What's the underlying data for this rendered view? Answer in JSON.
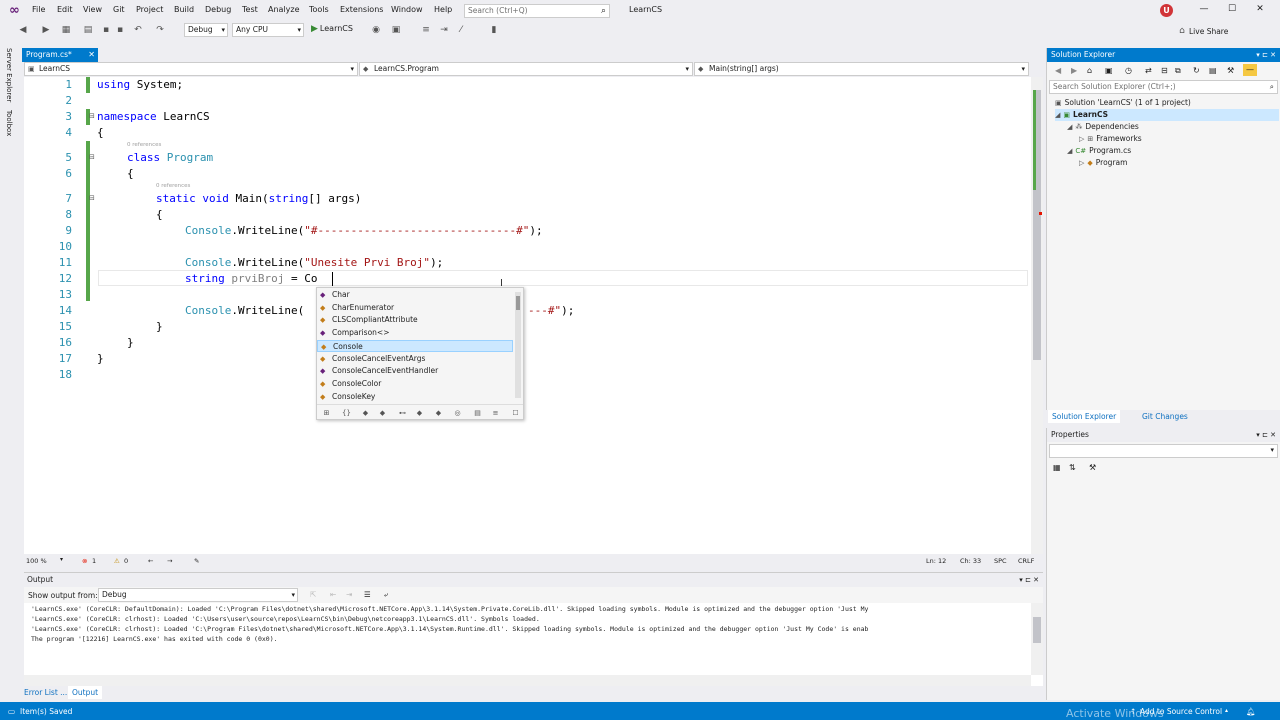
{
  "titlebar": {
    "menu": [
      "File",
      "Edit",
      "View",
      "Git",
      "Project",
      "Build",
      "Debug",
      "Test",
      "Analyze",
      "Tools",
      "Extensions",
      "Window",
      "Help"
    ],
    "search_placeholder": "Search (Ctrl+Q)",
    "project_name": "LearnCS",
    "avatar": "U"
  },
  "toolbar": {
    "config": "Debug",
    "platform": "Any CPU",
    "run_label": "LearnCS",
    "live_share": "Live Share"
  },
  "left_tabs": [
    "Server Explorer",
    "Toolbox"
  ],
  "document": {
    "tab_label": "Program.cs*",
    "nav_project": "LearnCS",
    "nav_class": "LearnCS.Program",
    "nav_member": "Main(string[] args)"
  },
  "editor": {
    "line_numbers": [
      "1",
      "2",
      "3",
      "4",
      "5",
      "6",
      "7",
      "8",
      "9",
      "10",
      "11",
      "12",
      "13",
      "14",
      "15",
      "16",
      "17",
      "18"
    ],
    "lines": {
      "l1_kw": "using",
      "l1_rest": " System;",
      "l3_kw": "namespace",
      "l3_rest": " LearnCS",
      "l4": "{",
      "lens_class": "0 references",
      "l5_kw": "class",
      "l5_ty": " Program",
      "l6": "{",
      "lens_main": "0 references",
      "l7_kw1": "static",
      "l7_kw2": " void",
      "l7_rest": " Main(",
      "l7_kw3": "string",
      "l7_rest2": "[] args)",
      "l8": "{",
      "l9_ty": "Console",
      "l9_rest": ".WriteLine(",
      "l9_str": "\"#------------------------------#\"",
      "l9_end": ");",
      "l11_ty": "Console",
      "l11_rest": ".WriteLine(",
      "l11_str": "\"Unesite Prvi Broj\"",
      "l11_end": ");",
      "l12_kw": "string",
      "l12_var": " prviBroj",
      "l12_rest": " = Co",
      "l14_ty": "Console",
      "l14_rest": ".WriteLine(",
      "l14_str": "---#\"",
      "l14_end": ");",
      "l15": "}",
      "l16": "}",
      "l17": "}"
    },
    "zoom": "100 %",
    "errors": "1",
    "warnings": "0",
    "line": "Ln: 12",
    "col": "Ch: 33",
    "spc": "SPC",
    "crlf": "CRLF"
  },
  "intellisense": {
    "items": [
      "Char",
      "CharEnumerator",
      "CLSCompliantAttribute",
      "Comparison<>",
      "Console",
      "ConsoleCancelEventArgs",
      "ConsoleCancelEventHandler",
      "ConsoleColor",
      "ConsoleKey"
    ],
    "selected": "Console"
  },
  "solution_explorer": {
    "title": "Solution Explorer",
    "search_placeholder": "Search Solution Explorer (Ctrl+;)",
    "tree": [
      "Solution 'LearnCS' (1 of 1 project)",
      "LearnCS",
      "Dependencies",
      "Frameworks",
      "Program.cs",
      "Program"
    ],
    "tab_solution": "Solution Explorer",
    "tab_git": "Git Changes"
  },
  "properties": {
    "title": "Properties"
  },
  "output": {
    "title": "Output",
    "show_from_label": "Show output from:",
    "show_from_value": "Debug",
    "lines": [
      "'LearnCS.exe' (CoreCLR: DefaultDomain): Loaded 'C:\\Program Files\\dotnet\\shared\\Microsoft.NETCore.App\\3.1.14\\System.Private.CoreLib.dll'. Skipped loading symbols. Module is optimized and the debugger option 'Just My",
      "'LearnCS.exe' (CoreCLR: clrhost): Loaded 'C:\\Users\\user\\source\\repos\\LearnCS\\bin\\Debug\\netcoreapp3.1\\LearnCS.dll'. Symbols loaded.",
      "'LearnCS.exe' (CoreCLR: clrhost): Loaded 'C:\\Program Files\\dotnet\\shared\\Microsoft.NETCore.App\\3.1.14\\System.Runtime.dll'. Skipped loading symbols. Module is optimized and the debugger option 'Just My Code' is enab",
      "The program '[12216] LearnCS.exe' has exited with code 0 (0x0)."
    ],
    "tab_errors": "Error List ...",
    "tab_output": "Output"
  },
  "statusbar": {
    "left": "Item(s) Saved",
    "source_control": "Add to Source Control",
    "watermark": "Activate Windows"
  }
}
